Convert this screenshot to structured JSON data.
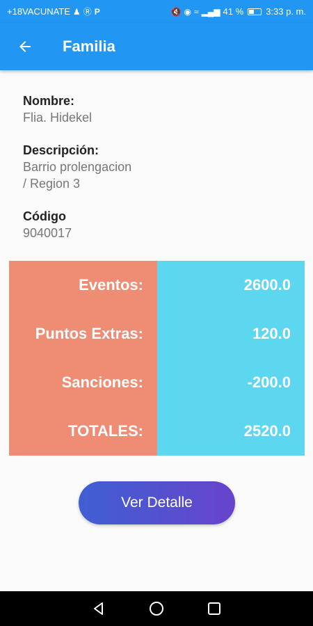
{
  "status_bar": {
    "left_text": "+18VACUNATE",
    "battery": "41 %",
    "time": "3:33 p. m."
  },
  "app_bar": {
    "title": "Familia",
    "back_icon": "arrow-left-icon"
  },
  "details": {
    "nombre_label": "Nombre:",
    "nombre_value": "Flia. Hidekel",
    "descripcion_label": "Descripción:",
    "descripcion_value": "Barrio prolengacion\n / Region 3",
    "codigo_label": "Código",
    "codigo_value": "9040017"
  },
  "summary": {
    "rows": [
      {
        "label": "Eventos:",
        "value": "2600.0"
      },
      {
        "label": "Puntos Extras:",
        "value": "120.0"
      },
      {
        "label": "Sanciones:",
        "value": "-200.0"
      },
      {
        "label": "TOTALES:",
        "value": "2520.0"
      }
    ],
    "left_color": "#ef8c74",
    "right_color": "#5dd6ef"
  },
  "actions": {
    "ver_detalle": "Ver Detalle"
  },
  "nav": {
    "back_icon": "triangle-back-icon",
    "home_icon": "circle-home-icon",
    "recents_icon": "square-recents-icon"
  },
  "colors": {
    "primary": "#2196f3",
    "button_start": "#3f5fd2",
    "button_end": "#6744cc"
  }
}
